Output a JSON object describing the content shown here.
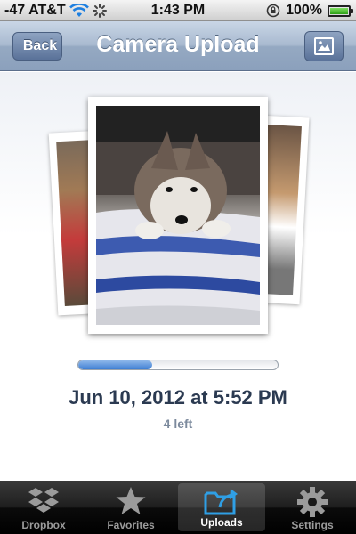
{
  "status_bar": {
    "signal": "-47",
    "carrier": "AT&T",
    "time": "1:43 PM",
    "battery": "100%"
  },
  "nav": {
    "title": "Camera Upload",
    "back_label": "Back"
  },
  "upload": {
    "progress": 0.37,
    "date": "Jun 10, 2012 at 5:52 PM",
    "remaining": "4 left"
  },
  "tabs": [
    {
      "label": "Dropbox",
      "icon": "dropbox-icon",
      "active": false
    },
    {
      "label": "Favorites",
      "icon": "star-icon",
      "active": false
    },
    {
      "label": "Uploads",
      "icon": "uploads-folder-icon",
      "active": true
    },
    {
      "label": "Settings",
      "icon": "gear-icon",
      "active": false
    }
  ],
  "colors": {
    "nav_blue": "#8ba0bc",
    "progress_blue": "#3f7fd3",
    "date_text": "#2b3a51",
    "tab_active_icon": "#2f9fe5"
  }
}
